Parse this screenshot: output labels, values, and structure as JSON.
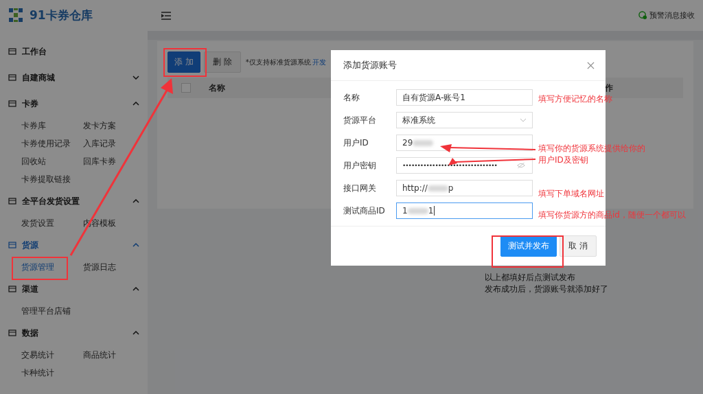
{
  "logo": {
    "text": "91卡券仓库"
  },
  "sidebar": {
    "groups": [
      {
        "label": "工作台",
        "selected": false
      },
      {
        "label": "自建商城",
        "selected": false,
        "expanded": false
      },
      {
        "label": "卡券",
        "selected": false,
        "expanded": true,
        "items": [
          {
            "label": "卡券库",
            "selected": false
          },
          {
            "label": "发卡方案",
            "selected": false
          },
          {
            "label": "卡券使用记录",
            "selected": false
          },
          {
            "label": "入库记录",
            "selected": false
          },
          {
            "label": "回收站",
            "selected": false
          },
          {
            "label": "回库卡券",
            "selected": false
          },
          {
            "label": "卡券提取链接",
            "selected": false
          }
        ]
      },
      {
        "label": "全平台发货设置",
        "selected": false,
        "expanded": true,
        "items": [
          {
            "label": "发货设置",
            "selected": false
          },
          {
            "label": "内容模板",
            "selected": false
          }
        ]
      },
      {
        "label": "货源",
        "selected": true,
        "expanded": true,
        "items": [
          {
            "label": "货源管理",
            "selected": true
          },
          {
            "label": "货源日志",
            "selected": false
          }
        ]
      },
      {
        "label": "渠道",
        "selected": false,
        "expanded": true,
        "items": [
          {
            "label": "管理平台店铺",
            "selected": false
          }
        ]
      },
      {
        "label": "数据",
        "selected": false,
        "expanded": true,
        "items": [
          {
            "label": "交易统计",
            "selected": false
          },
          {
            "label": "商品统计",
            "selected": false
          },
          {
            "label": "卡种统计",
            "selected": false
          }
        ]
      }
    ]
  },
  "header": {
    "alert_link": "预警消息接收"
  },
  "toolbar": {
    "buttons": [
      "添 加",
      "删 除"
    ],
    "note": "*仅支持标准货源系统",
    "link": "开发"
  },
  "table": {
    "select_all_checked": false,
    "columns": [
      "名称",
      "作"
    ]
  },
  "dialog": {
    "title": "添加货源账号",
    "fields": [
      {
        "label": "名称",
        "kind": "text",
        "value": "自有货源A-账号1",
        "focused": false
      },
      {
        "label": "货源平台",
        "kind": "select",
        "value": "标准系统",
        "focused": false
      },
      {
        "label": "用户ID",
        "kind": "text",
        "value": "29",
        "blurred": true,
        "focused": false
      },
      {
        "label": "用户密钥",
        "kind": "password",
        "value": "••••••••••••••••••••••••••••••••",
        "focused": false
      },
      {
        "label": "接口网关",
        "kind": "text",
        "value": "http://",
        "blurred": true,
        "tail": "p",
        "focused": false
      },
      {
        "label": "测试商品ID",
        "kind": "text",
        "value": "1",
        "blurred": true,
        "tail": "1",
        "focused": true
      }
    ],
    "buttons": [
      "测试并发布",
      "取 消"
    ]
  },
  "annotations": {
    "notes": [
      "填写方便记忆的名称",
      "填写你的货源系统提供给你的",
      "用户ID及密钥",
      "填写下单域名网址",
      "填写你货源方的商品id，随便一个都可以"
    ],
    "caption": [
      "以上都填好后点测试发布",
      "发布成功后，货源账号就添加好了"
    ]
  }
}
